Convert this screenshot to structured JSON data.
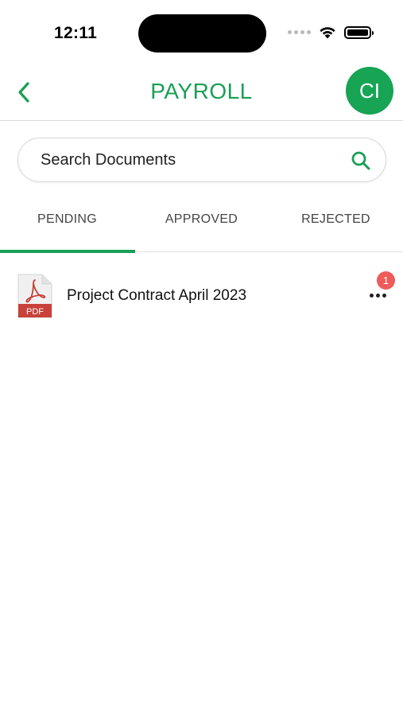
{
  "status_bar": {
    "time": "12:11"
  },
  "header": {
    "title": "PAYROLL",
    "avatar_initials": "CI"
  },
  "search": {
    "placeholder": "Search Documents",
    "value": ""
  },
  "tabs": [
    {
      "label": "PENDING",
      "active": true
    },
    {
      "label": "APPROVED",
      "active": false
    },
    {
      "label": "REJECTED",
      "active": false
    }
  ],
  "documents": [
    {
      "name": "Project Contract April 2023",
      "file_type": "PDF",
      "badge_count": "1"
    }
  ],
  "colors": {
    "accent": "#1a9f55",
    "badge": "#ee5b5b",
    "pdf_red": "#c8413b"
  }
}
